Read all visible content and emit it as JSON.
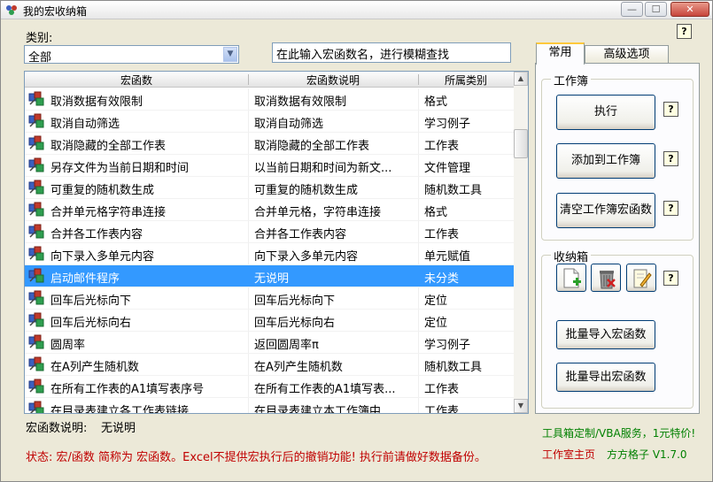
{
  "window": {
    "title": "我的宏收纳箱",
    "buttons": {
      "minimize": "—",
      "maximize": "☐",
      "close": "✕"
    }
  },
  "help_glyph": "?",
  "category": {
    "label": "类别:",
    "selected": "全部"
  },
  "search": {
    "placeholder": "在此输入宏函数名，进行模糊查找"
  },
  "list": {
    "columns": [
      "宏函数",
      "宏函数说明",
      "所属类别"
    ],
    "selected_index": 8,
    "rows": [
      {
        "name": "取消数据有效限制",
        "desc": "取消数据有效限制",
        "category": "格式"
      },
      {
        "name": "取消自动筛选",
        "desc": "取消自动筛选",
        "category": "学习例子"
      },
      {
        "name": "取消隐藏的全部工作表",
        "desc": "取消隐藏的全部工作表",
        "category": "工作表"
      },
      {
        "name": "另存文件为当前日期和时间",
        "desc": "以当前日期和时间为新文...",
        "category": "文件管理"
      },
      {
        "name": "可重复的随机数生成",
        "desc": "可重复的随机数生成",
        "category": "随机数工具"
      },
      {
        "name": "合并单元格字符串连接",
        "desc": "合并单元格，字符串连接",
        "category": "格式"
      },
      {
        "name": "合并各工作表内容",
        "desc": "合并各工作表内容",
        "category": "工作表"
      },
      {
        "name": "向下录入多单元内容",
        "desc": "向下录入多单元内容",
        "category": "单元赋值"
      },
      {
        "name": "启动邮件程序",
        "desc": "无说明",
        "category": "未分类"
      },
      {
        "name": "回车后光标向下",
        "desc": "回车后光标向下",
        "category": "定位"
      },
      {
        "name": "回车后光标向右",
        "desc": "回车后光标向右",
        "category": "定位"
      },
      {
        "name": "圆周率",
        "desc": "返回圆周率π",
        "category": "学习例子"
      },
      {
        "name": "在A列产生随机数",
        "desc": "在A列产生随机数",
        "category": "随机数工具"
      },
      {
        "name": "在所有工作表的A1填写表序号",
        "desc": "在所有工作表的A1填写表...",
        "category": "工作表"
      },
      {
        "name": "在目录表建立各工作表链接",
        "desc": "在目录表建立本工作簿中...",
        "category": "工作表"
      }
    ]
  },
  "description": {
    "label": "宏函数说明:",
    "value": "无说明"
  },
  "status": "状态: 宏/函数 简称为 宏函数。Excel不提供宏执行后的撤销功能! 执行前请做好数据备份。",
  "footer": {
    "promo": "工具箱定制/VBA服务，1元特价!",
    "studio_link": "工作室主页",
    "brand": "方方格子 V1.7.0"
  },
  "tabs": [
    "常用",
    "高级选项"
  ],
  "workbook_group": {
    "title": "工作簿",
    "buttons": [
      "执行",
      "添加到工作簿",
      "清空工作簿宏函数"
    ]
  },
  "box_group": {
    "title": "收纳箱",
    "icons": [
      "new-file-icon",
      "recycle-bin-icon",
      "edit-note-icon"
    ],
    "buttons": [
      "批量导入宏函数",
      "批量导出宏函数"
    ]
  }
}
